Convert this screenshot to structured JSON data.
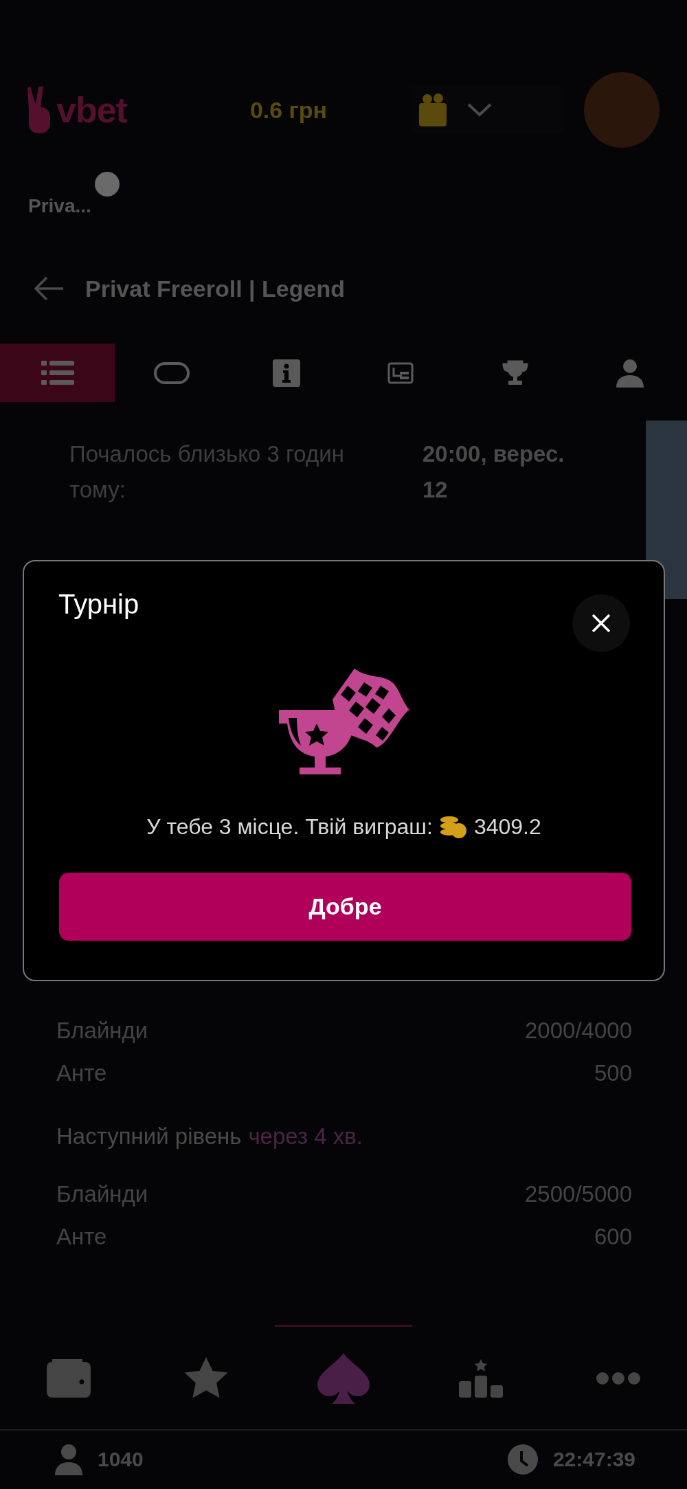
{
  "header": {
    "logo": "vbet",
    "balance": "0.6 грн"
  },
  "account": {
    "name": "Priva..."
  },
  "page": {
    "title": "Privat Freeroll | Legend"
  },
  "tabs": [
    {
      "kind": "list",
      "selected": true
    },
    {
      "kind": "table",
      "selected": false
    },
    {
      "kind": "info",
      "selected": false
    },
    {
      "kind": "schedule",
      "selected": false
    },
    {
      "kind": "trophy",
      "selected": false
    },
    {
      "kind": "user",
      "selected": false
    }
  ],
  "start": {
    "label": "Почалось близько 3 годин тому:",
    "value": "20:00, верес. 12"
  },
  "current_level": [
    {
      "label": "Блайнди",
      "value": "2000/4000"
    },
    {
      "label": "Анте",
      "value": "500"
    }
  ],
  "next_level": {
    "label": "Наступний рівень",
    "countdown": "через 4 хв.",
    "rows": [
      {
        "label": "Блайнди",
        "value": "2500/5000"
      },
      {
        "label": "Анте",
        "value": "600"
      }
    ]
  },
  "bottom_nav": [
    {
      "kind": "wallet",
      "selected": false
    },
    {
      "kind": "star",
      "selected": false
    },
    {
      "kind": "spade",
      "selected": true
    },
    {
      "kind": "podium",
      "selected": false
    },
    {
      "kind": "more",
      "selected": false
    }
  ],
  "status_bar": {
    "players": "1040",
    "time": "22:47:39"
  },
  "dialog": {
    "title": "Турнір",
    "message": "У тебе 3 місце. Твій виграш:",
    "prize": "3409.2",
    "button": "Добре"
  }
}
